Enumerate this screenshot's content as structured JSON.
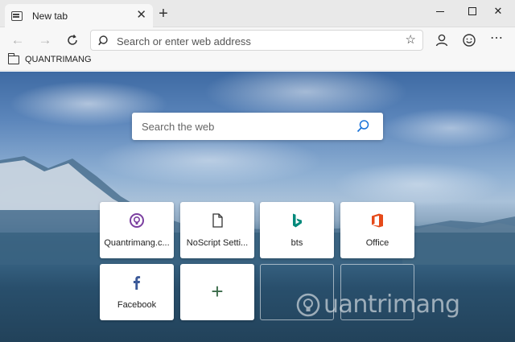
{
  "tab": {
    "title": "New tab",
    "close_glyph": "✕"
  },
  "titlebar": {
    "new_tab_glyph": "+",
    "close_window_glyph": "✕"
  },
  "toolbar": {
    "back_glyph": "←",
    "forward_glyph": "→",
    "address_placeholder": "Search or enter web address",
    "favorite_glyph": "☆",
    "menu_glyph": "⋯"
  },
  "favorites": {
    "items": [
      {
        "label": "QUANTRIMANG",
        "icon": "folder-icon"
      }
    ]
  },
  "newtab": {
    "search_placeholder": "Search the web",
    "tiles": [
      {
        "label": "Quantrimang.c...",
        "icon": "quantrimang-icon",
        "color": "#7b3fa0"
      },
      {
        "label": "NoScript Setti...",
        "icon": "document-icon",
        "color": "#333333"
      },
      {
        "label": "bts",
        "icon": "bing-icon",
        "color": "#00897b"
      },
      {
        "label": "Office",
        "icon": "office-icon",
        "color": "#e64a19"
      },
      {
        "label": "Facebook",
        "icon": "facebook-icon",
        "color": "#3b5998"
      }
    ],
    "add_glyph": "+"
  },
  "watermark": {
    "text": "uantrimang"
  }
}
